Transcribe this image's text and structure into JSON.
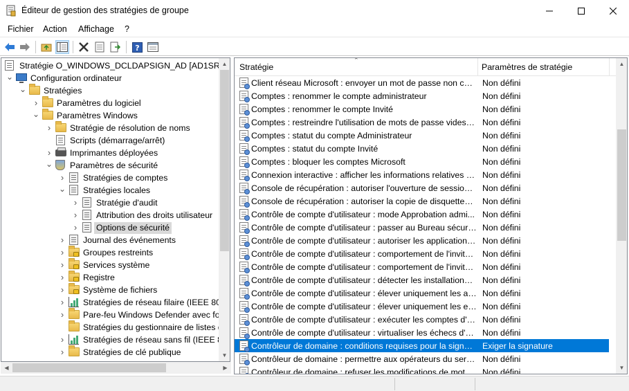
{
  "window": {
    "title": "Éditeur de gestion des stratégies de groupe"
  },
  "menu": [
    "Fichier",
    "Action",
    "Affichage",
    "?"
  ],
  "toolbar": {
    "buttons": [
      "back-icon",
      "forward-icon",
      "up-folder-icon",
      "show-hide-tree-icon",
      "delete-icon",
      "properties-icon",
      "export-list-icon",
      "help-icon",
      "console-tree-icon"
    ]
  },
  "tree": {
    "root": "Stratégie O_WINDOWS_DCLDAPSIGN_AD [AD1SRV.NCA",
    "items": [
      {
        "label": "Configuration ordinateur",
        "expander": "expanded",
        "icon": "computer-icon"
      },
      {
        "label": "Stratégies",
        "expander": "expanded",
        "icon": "folder-icon"
      },
      {
        "label": "Paramètres du logiciel",
        "expander": "collapsed",
        "icon": "folder-icon"
      },
      {
        "label": "Paramètres Windows",
        "expander": "expanded",
        "icon": "folder-icon"
      },
      {
        "label": "Stratégie de résolution de noms",
        "expander": "collapsed",
        "icon": "folder-icon"
      },
      {
        "label": "Scripts (démarrage/arrêt)",
        "expander": "none",
        "icon": "script-icon"
      },
      {
        "label": "Imprimantes déployées",
        "expander": "collapsed",
        "icon": "printer-icon"
      },
      {
        "label": "Paramètres de sécurité",
        "expander": "expanded",
        "icon": "security-settings-icon"
      },
      {
        "label": "Stratégies de comptes",
        "expander": "collapsed",
        "icon": "policy-folder-icon"
      },
      {
        "label": "Stratégies locales",
        "expander": "expanded",
        "icon": "policy-folder-icon"
      },
      {
        "label": "Stratégie d'audit",
        "expander": "collapsed",
        "icon": "policy-folder-icon"
      },
      {
        "label": "Attribution des droits utilisateur",
        "expander": "collapsed",
        "icon": "policy-folder-icon"
      },
      {
        "label": "Options de sécurité",
        "expander": "collapsed",
        "icon": "policy-folder-icon",
        "selected": true
      },
      {
        "label": "Journal des événements",
        "expander": "collapsed",
        "icon": "policy-folder-icon"
      },
      {
        "label": "Groupes restreints",
        "expander": "collapsed",
        "icon": "locked-folder-icon"
      },
      {
        "label": "Services système",
        "expander": "collapsed",
        "icon": "locked-folder-icon"
      },
      {
        "label": "Registre",
        "expander": "collapsed",
        "icon": "locked-folder-icon"
      },
      {
        "label": "Système de fichiers",
        "expander": "collapsed",
        "icon": "locked-folder-icon"
      },
      {
        "label": "Stratégies de réseau filaire (IEEE 802.3",
        "expander": "collapsed",
        "icon": "network-chart-icon"
      },
      {
        "label": "Pare-feu Windows Defender avec fon",
        "expander": "collapsed",
        "icon": "folder-icon"
      },
      {
        "label": "Stratégies du gestionnaire de listes de",
        "expander": "none",
        "icon": "folder-icon"
      },
      {
        "label": "Stratégies de réseau sans fil (IEEE 802.",
        "expander": "collapsed",
        "icon": "network-chart-icon"
      },
      {
        "label": "Stratégies de clé publique",
        "expander": "collapsed",
        "icon": "folder-icon"
      }
    ]
  },
  "list": {
    "columns": [
      "Stratégie",
      "Paramètres de stratégie"
    ],
    "rows": [
      {
        "policy": "Client réseau Microsoft : envoyer un mot de passe non chiff...",
        "setting": "Non défini"
      },
      {
        "policy": "Comptes : renommer le compte administrateur",
        "setting": "Non défini"
      },
      {
        "policy": "Comptes : renommer le compte Invité",
        "setting": "Non défini"
      },
      {
        "policy": "Comptes : restreindre l'utilisation de mots de passe vides pa...",
        "setting": "Non défini"
      },
      {
        "policy": "Comptes : statut du compte Administrateur",
        "setting": "Non défini"
      },
      {
        "policy": "Comptes : statut du compte Invité",
        "setting": "Non défini"
      },
      {
        "policy": "Comptes : bloquer les comptes Microsoft",
        "setting": "Non défini"
      },
      {
        "policy": "Connexion interactive : afficher les informations relatives à l'...",
        "setting": "Non défini"
      },
      {
        "policy": "Console de récupération : autoriser l'ouverture de session d'...",
        "setting": "Non défini"
      },
      {
        "policy": "Console de récupération : autoriser la copie de disquettes et ...",
        "setting": "Non défini"
      },
      {
        "policy": "Contrôle de compte d'utilisateur : mode Approbation admi...",
        "setting": "Non défini"
      },
      {
        "policy": "Contrôle de compte d'utilisateur : passer au Bureau sécurisé ...",
        "setting": "Non défini"
      },
      {
        "policy": "Contrôle de compte d'utilisateur : autoriser les applications ...",
        "setting": "Non défini"
      },
      {
        "policy": "Contrôle de compte d'utilisateur : comportement de l'invite ...",
        "setting": "Non défini"
      },
      {
        "policy": "Contrôle de compte d'utilisateur : comportement de l'invite ...",
        "setting": "Non défini"
      },
      {
        "policy": "Contrôle de compte d'utilisateur : détecter les installations d...",
        "setting": "Non défini"
      },
      {
        "policy": "Contrôle de compte d'utilisateur : élever uniquement les ap...",
        "setting": "Non défini"
      },
      {
        "policy": "Contrôle de compte d'utilisateur : élever uniquement les exé...",
        "setting": "Non défini"
      },
      {
        "policy": "Contrôle de compte d'utilisateur : exécuter les comptes d'ad...",
        "setting": "Non défini"
      },
      {
        "policy": "Contrôle de compte d'utilisateur : virtualiser les échecs d'écr...",
        "setting": "Non défini"
      },
      {
        "policy": "Contrôleur de domaine : conditions requises pour la signatu...",
        "setting": "Exiger la signature",
        "selected": true
      },
      {
        "policy": "Contrôleur de domaine : permettre aux opérateurs du serve...",
        "setting": "Non défini"
      },
      {
        "policy": "Contrôleur de domaine : refuser les modifications de mot d...",
        "setting": "Non défini"
      }
    ]
  },
  "colors": {
    "selection": "#0078d7",
    "tree_selection": "#d9d9d9",
    "nav_arrow": "#2e7bd6"
  }
}
